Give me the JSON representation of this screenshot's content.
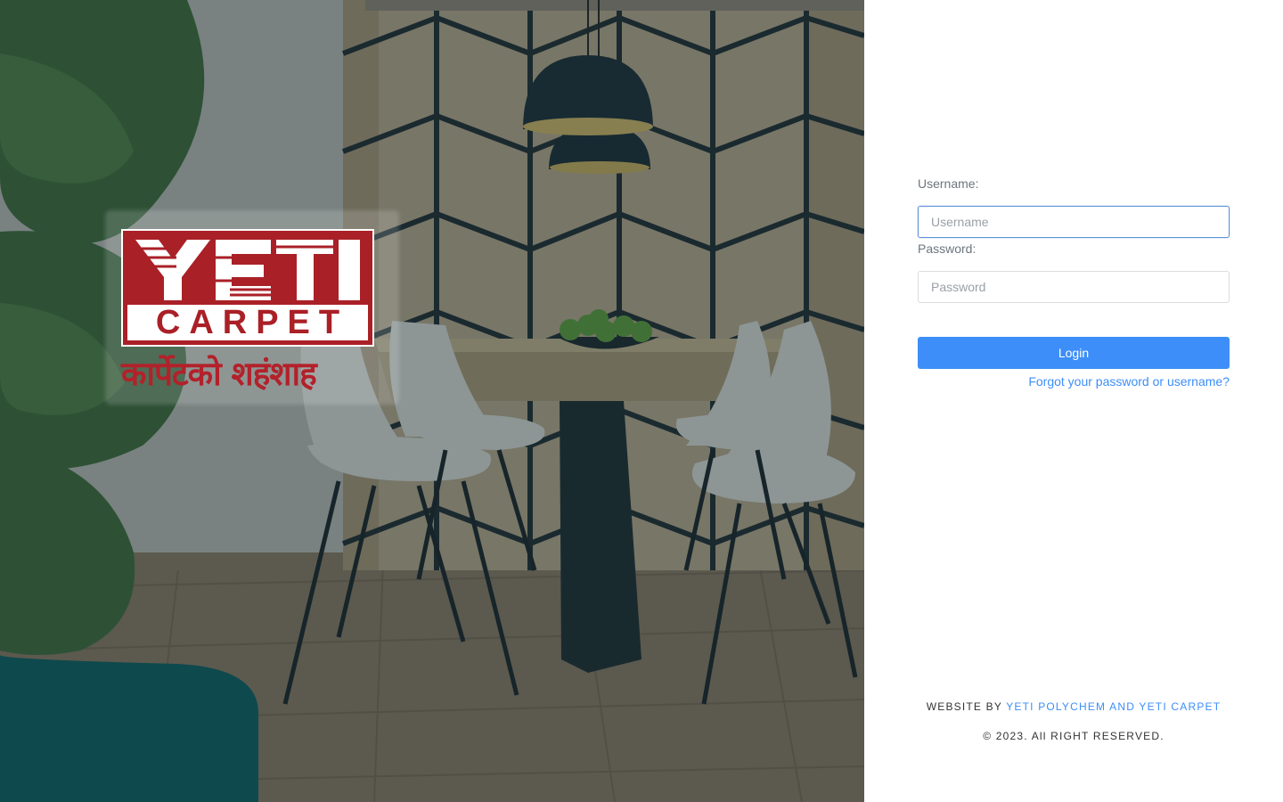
{
  "logo": {
    "brand_top": "YETI",
    "brand_bottom": "CARPET",
    "tagline": "कार्पेटको शहंशाह",
    "brand_color": "#aa2027"
  },
  "login": {
    "username_label": "Username:",
    "username_placeholder": "Username",
    "password_label": "Password:",
    "password_placeholder": "Password",
    "login_button": "Login",
    "forgot_link": "Forgot your password or username?",
    "accent_color": "#3d8ef8"
  },
  "footer": {
    "website_by_prefix": "WEBSITE BY",
    "website_by_link": "YETI POLYCHEM AND YETI CARPET",
    "copyright": "© 2023. All RIGHT RESERVED."
  }
}
